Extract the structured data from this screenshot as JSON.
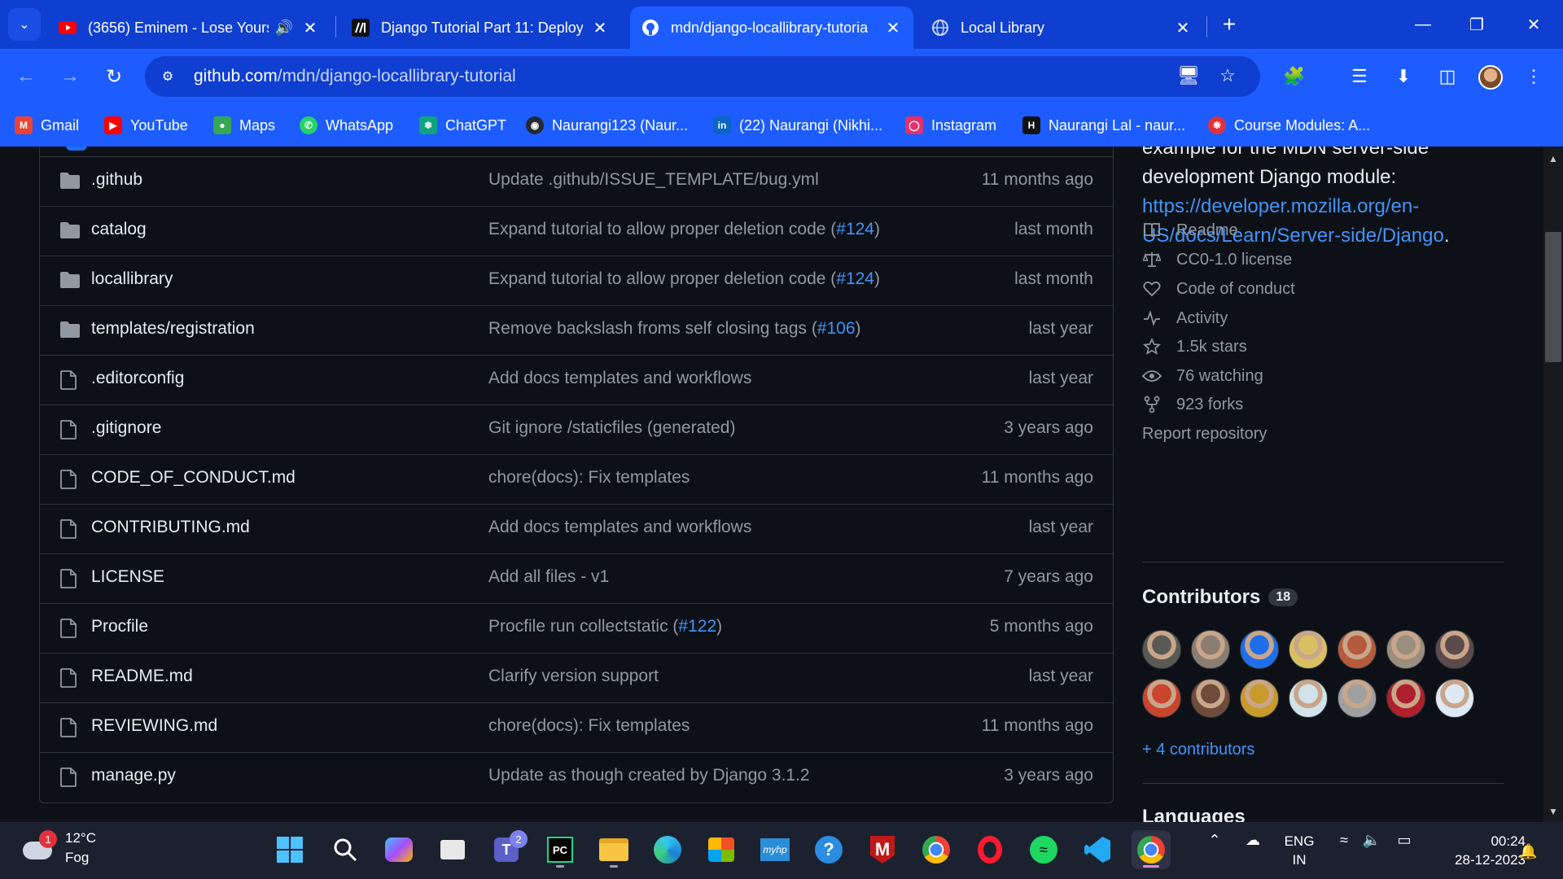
{
  "browser": {
    "tabs": [
      {
        "title": "(3656) Eminem - Lose Yours",
        "favicon": "youtube-icon",
        "audio": true
      },
      {
        "title": "Django Tutorial Part 11: Deploy",
        "favicon": "mdn-icon"
      },
      {
        "title": "mdn/django-locallibrary-tutoria",
        "favicon": "github-icon",
        "active": true
      },
      {
        "title": "Local Library",
        "favicon": "globe-icon"
      }
    ],
    "url_host": "github.com",
    "url_path": "/mdn/django-locallibrary-tutorial",
    "bookmarks": [
      {
        "label": "Gmail",
        "icon": "gmail-icon",
        "color": "#ea4335"
      },
      {
        "label": "YouTube",
        "icon": "youtube-icon",
        "color": "#ff0000"
      },
      {
        "label": "Maps",
        "icon": "maps-icon",
        "color": "#34a853"
      },
      {
        "label": "WhatsApp",
        "icon": "whatsapp-icon",
        "color": "#25d366"
      },
      {
        "label": "ChatGPT",
        "icon": "chatgpt-icon",
        "color": "#10a37f"
      },
      {
        "label": "Naurangi123 (Naur...",
        "icon": "github-icon",
        "color": "#24292f"
      },
      {
        "label": "(22) Naurangi (Nikhi...",
        "icon": "linkedin-icon",
        "color": "#0a66c2"
      },
      {
        "label": "Instagram",
        "icon": "instagram-icon",
        "color": "#e1306c"
      },
      {
        "label": "Naurangi Lal - naur...",
        "icon": "hackerrank-icon",
        "color": "#111111"
      },
      {
        "label": "Course Modules: A...",
        "icon": "course-icon",
        "color": "#e0323c"
      }
    ]
  },
  "files": [
    {
      "name": ".github",
      "type": "dir",
      "msg": "Update .github/ISSUE_TEMPLATE/bug.yml",
      "pr": "",
      "date": "11 months ago"
    },
    {
      "name": "catalog",
      "type": "dir",
      "msg": "Expand tutorial to allow proper deletion code (",
      "pr": "#124",
      "date": "last month"
    },
    {
      "name": "locallibrary",
      "type": "dir",
      "msg": "Expand tutorial to allow proper deletion code (",
      "pr": "#124",
      "date": "last month"
    },
    {
      "name": "templates/registration",
      "type": "dir",
      "msg": "Remove backslash froms self closing tags (",
      "pr": "#106",
      "date": "last year"
    },
    {
      "name": ".editorconfig",
      "type": "file",
      "msg": "Add docs templates and workflows",
      "pr": "",
      "date": "last year"
    },
    {
      "name": ".gitignore",
      "type": "file",
      "msg": "Git ignore /staticfiles (generated)",
      "pr": "",
      "date": "3 years ago"
    },
    {
      "name": "CODE_OF_CONDUCT.md",
      "type": "file",
      "msg": "chore(docs): Fix templates",
      "pr": "",
      "date": "11 months ago"
    },
    {
      "name": "CONTRIBUTING.md",
      "type": "file",
      "msg": "Add docs templates and workflows",
      "pr": "",
      "date": "last year"
    },
    {
      "name": "LICENSE",
      "type": "file",
      "msg": "Add all files - v1",
      "pr": "",
      "date": "7 years ago"
    },
    {
      "name": "Procfile",
      "type": "file",
      "msg": "Procfile run collectstatic (",
      "pr": "#122",
      "date": "5 months ago"
    },
    {
      "name": "README.md",
      "type": "file",
      "msg": "Clarify version support",
      "pr": "",
      "date": "last year"
    },
    {
      "name": "REVIEWING.md",
      "type": "file",
      "msg": "chore(docs): Fix templates",
      "pr": "",
      "date": "11 months ago"
    },
    {
      "name": "manage.py",
      "type": "file",
      "msg": "Update as though created by Django 3.1.2",
      "pr": "",
      "date": "3 years ago"
    }
  ],
  "about": {
    "text_top": "example for the MDN server-side",
    "text_mid": "development Django module:",
    "link_line1": "https://developer.mozilla.org/en-",
    "link_line2": "US/docs/Learn/Server-side/Django",
    "period": "."
  },
  "meta": [
    {
      "label": "Readme",
      "icon": "book-icon"
    },
    {
      "label": "CC0-1.0 license",
      "icon": "law-icon"
    },
    {
      "label": "Code of conduct",
      "icon": "heart-icon"
    },
    {
      "label": "Activity",
      "icon": "pulse-icon"
    },
    {
      "label": "1.5k stars",
      "icon": "star-icon"
    },
    {
      "label": "76 watching",
      "icon": "eye-icon"
    },
    {
      "label": "923 forks",
      "icon": "fork-icon"
    }
  ],
  "report_label": "Report repository",
  "contributors": {
    "title": "Contributors",
    "count": "18",
    "more": "+ 4 contributors",
    "avatar_colors": [
      "#5a5a55",
      "#8a7d72",
      "#1f6feb",
      "#d8c062",
      "#b65a3c",
      "#9a8f7f",
      "#5d4a4a",
      "#c9452e",
      "#6e4b3a",
      "#c79a2b",
      "#cfe3e8",
      "#9f9f9f",
      "#b0202c",
      "#dfe8f5"
    ]
  },
  "languages_title": "Languages",
  "taskbar": {
    "weather_temp": "12°C",
    "weather_desc": "Fog",
    "weather_badge": "1",
    "teams_badge": "2",
    "lang_top": "ENG",
    "lang_bottom": "IN",
    "time": "00:24",
    "date": "28-12-2023"
  }
}
